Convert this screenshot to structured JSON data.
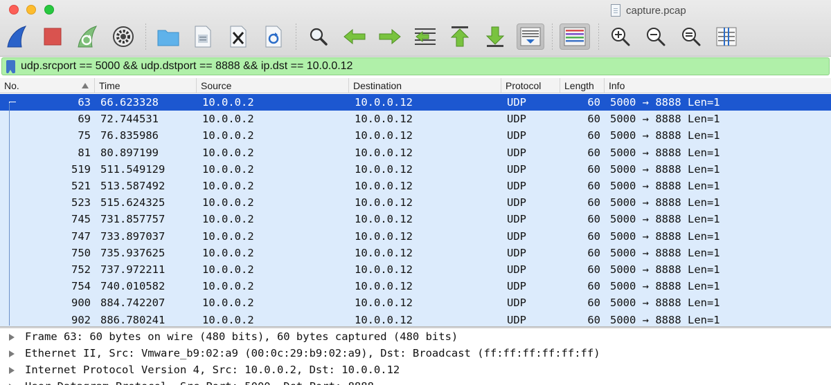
{
  "window": {
    "title": "capture.pcap"
  },
  "toolbar": {
    "buttons": [
      "start-capture",
      "stop-capture",
      "restart-capture",
      "capture-options",
      "open-file",
      "save-file",
      "close-file",
      "reload-file",
      "find-packet",
      "go-back",
      "go-forward",
      "go-to-packet",
      "go-to-first",
      "go-to-last",
      "auto-scroll",
      "colorize",
      "zoom-in",
      "zoom-out",
      "normal-size",
      "resize-columns"
    ]
  },
  "filter": {
    "value": "udp.srcport == 5000 && udp.dstport == 8888 && ip.dst == 10.0.0.12"
  },
  "packet_list": {
    "columns": [
      "No.",
      "Time",
      "Source",
      "Destination",
      "Protocol",
      "Length",
      "Info"
    ],
    "rows": [
      {
        "no": "63",
        "time": "66.623328",
        "src": "10.0.0.2",
        "dst": "10.0.0.12",
        "proto": "UDP",
        "len": "60",
        "info": "5000 → 8888 Len=1"
      },
      {
        "no": "69",
        "time": "72.744531",
        "src": "10.0.0.2",
        "dst": "10.0.0.12",
        "proto": "UDP",
        "len": "60",
        "info": "5000 → 8888 Len=1"
      },
      {
        "no": "75",
        "time": "76.835986",
        "src": "10.0.0.2",
        "dst": "10.0.0.12",
        "proto": "UDP",
        "len": "60",
        "info": "5000 → 8888 Len=1"
      },
      {
        "no": "81",
        "time": "80.897199",
        "src": "10.0.0.2",
        "dst": "10.0.0.12",
        "proto": "UDP",
        "len": "60",
        "info": "5000 → 8888 Len=1"
      },
      {
        "no": "519",
        "time": "511.549129",
        "src": "10.0.0.2",
        "dst": "10.0.0.12",
        "proto": "UDP",
        "len": "60",
        "info": "5000 → 8888 Len=1"
      },
      {
        "no": "521",
        "time": "513.587492",
        "src": "10.0.0.2",
        "dst": "10.0.0.12",
        "proto": "UDP",
        "len": "60",
        "info": "5000 → 8888 Len=1"
      },
      {
        "no": "523",
        "time": "515.624325",
        "src": "10.0.0.2",
        "dst": "10.0.0.12",
        "proto": "UDP",
        "len": "60",
        "info": "5000 → 8888 Len=1"
      },
      {
        "no": "745",
        "time": "731.857757",
        "src": "10.0.0.2",
        "dst": "10.0.0.12",
        "proto": "UDP",
        "len": "60",
        "info": "5000 → 8888 Len=1"
      },
      {
        "no": "747",
        "time": "733.897037",
        "src": "10.0.0.2",
        "dst": "10.0.0.12",
        "proto": "UDP",
        "len": "60",
        "info": "5000 → 8888 Len=1"
      },
      {
        "no": "750",
        "time": "735.937625",
        "src": "10.0.0.2",
        "dst": "10.0.0.12",
        "proto": "UDP",
        "len": "60",
        "info": "5000 → 8888 Len=1"
      },
      {
        "no": "752",
        "time": "737.972211",
        "src": "10.0.0.2",
        "dst": "10.0.0.12",
        "proto": "UDP",
        "len": "60",
        "info": "5000 → 8888 Len=1"
      },
      {
        "no": "754",
        "time": "740.010582",
        "src": "10.0.0.2",
        "dst": "10.0.0.12",
        "proto": "UDP",
        "len": "60",
        "info": "5000 → 8888 Len=1"
      },
      {
        "no": "900",
        "time": "884.742207",
        "src": "10.0.0.2",
        "dst": "10.0.0.12",
        "proto": "UDP",
        "len": "60",
        "info": "5000 → 8888 Len=1"
      },
      {
        "no": "902",
        "time": "886.780241",
        "src": "10.0.0.2",
        "dst": "10.0.0.12",
        "proto": "UDP",
        "len": "60",
        "info": "5000 → 8888 Len=1"
      }
    ],
    "selected_index": 0
  },
  "details": {
    "items": [
      "Frame 63: 60 bytes on wire (480 bits), 60 bytes captured (480 bits)",
      "Ethernet II, Src: Vmware_b9:02:a9 (00:0c:29:b9:02:a9), Dst: Broadcast (ff:ff:ff:ff:ff:ff)",
      "Internet Protocol Version 4, Src: 10.0.0.2, Dst: 10.0.0.12",
      "User Datagram Protocol, Src Port: 5000, Dst Port: 8888"
    ]
  },
  "colors": {
    "filter_ok": "#b0f0a9",
    "row_bg": "#dcebfc",
    "row_selected": "#1c57d0"
  }
}
